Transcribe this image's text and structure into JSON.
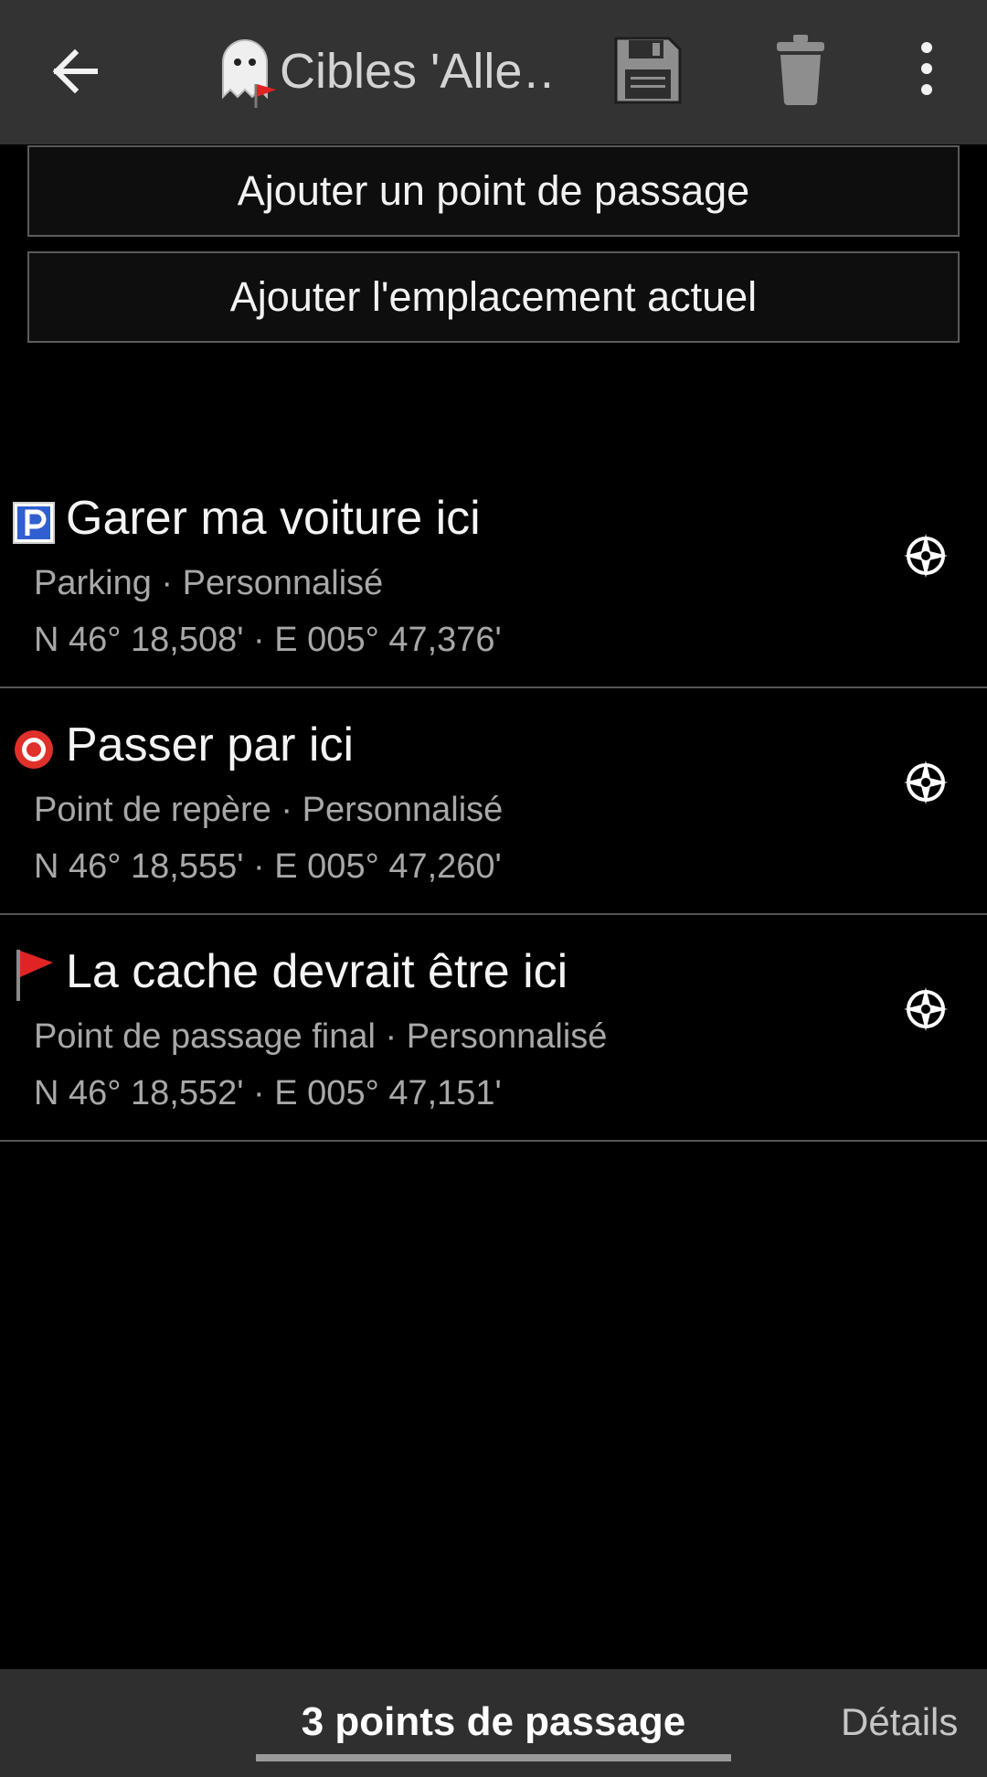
{
  "header": {
    "title": "Cibles 'Alle…",
    "icons": [
      "back-arrow-icon",
      "ghost-cache-icon",
      "save-icon",
      "trash-icon",
      "more-vert-icon"
    ]
  },
  "actions": {
    "add_waypoint": "Ajouter un point de passage",
    "add_current_location": "Ajouter l'emplacement actuel"
  },
  "waypoints": [
    {
      "name": "Garer ma voiture ici",
      "meta": "Parking · Personnalisé",
      "coords": "N 46° 18,508' · E 005° 47,376'",
      "icon": "parking-icon"
    },
    {
      "name": "Passer par ici",
      "meta": "Point de repère · Personnalisé",
      "coords": "N 46° 18,555' · E 005° 47,260'",
      "icon": "reference-point-icon"
    },
    {
      "name": "La cache devrait être ici",
      "meta": "Point de passage final · Personnalisé",
      "coords": "N 46° 18,552' · E 005° 47,151'",
      "icon": "final-flag-icon"
    }
  ],
  "tabs": {
    "waypoints": "3 points de passage",
    "details": "Détails"
  },
  "colors": {
    "appbar": "#333333",
    "background": "#000000",
    "bottombar": "#2f2f2f",
    "secondary_text": "#a8a8a8",
    "parking_blue": "#2f5fd0",
    "reference_red": "#e0302a",
    "flag_red": "#e02424"
  }
}
